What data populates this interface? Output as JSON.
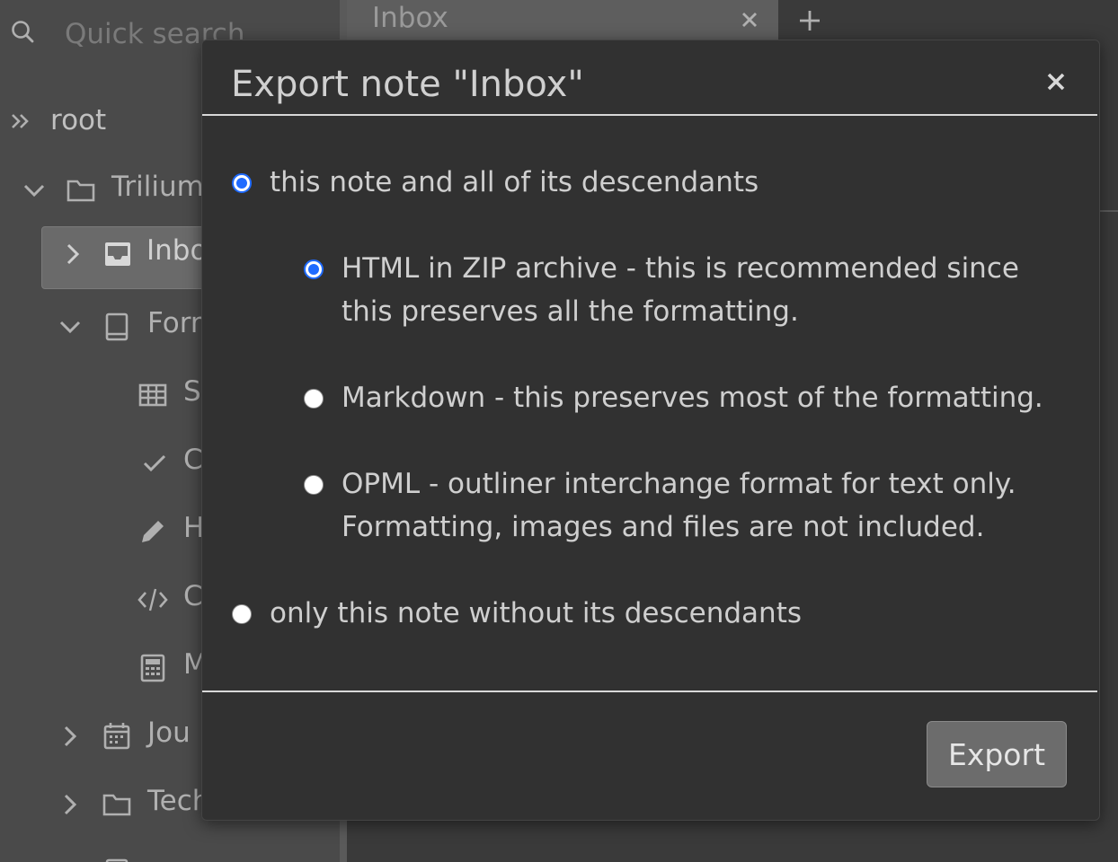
{
  "left_pane": {
    "search_placeholder": "Quick search",
    "tree": {
      "root_label": "root",
      "items": [
        {
          "label": "Trilium",
          "icon": "folder-icon"
        },
        {
          "label": "Inbox",
          "icon": "inbox-icon"
        },
        {
          "label": "Form",
          "icon": "book-icon"
        },
        {
          "label": "S",
          "icon": "table-icon"
        },
        {
          "label": "C",
          "icon": "check-icon"
        },
        {
          "label": "H",
          "icon": "pencil-icon"
        },
        {
          "label": "C",
          "icon": "code-icon"
        },
        {
          "label": "M",
          "icon": "calculator-icon"
        },
        {
          "label": "Jou",
          "icon": "calendar-icon"
        },
        {
          "label": "Tech",
          "icon": "folder-icon"
        }
      ]
    }
  },
  "tabs": [
    {
      "title": "Inbox"
    }
  ],
  "dialog": {
    "title": "Export note \"Inbox\"",
    "scope_options": [
      {
        "label": "this note and all of its descendants",
        "checked": true
      },
      {
        "label": "only this note without its descendants",
        "checked": false
      }
    ],
    "format_options": [
      {
        "line1": "HTML in ZIP archive - this is recommended since",
        "line2": "this preserves all the formatting.",
        "checked": true
      },
      {
        "line1": "Markdown - this preserves most of the formatting.",
        "line2": "",
        "checked": false
      },
      {
        "line1": "OPML - outliner interchange format for text only.",
        "line2": "Formatting, images and files are not included.",
        "checked": false
      }
    ],
    "export_label": "Export"
  },
  "colors": {
    "accent": "#1f6bff",
    "modal_bg": "#313131",
    "sidebar_bg": "#4a4a4a"
  }
}
